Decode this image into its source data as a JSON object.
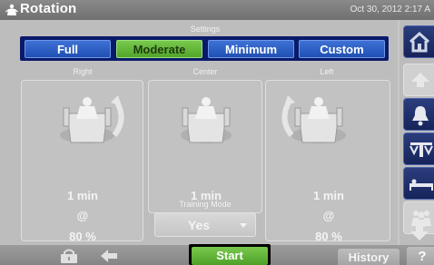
{
  "app": {
    "title": "Rotation",
    "datetime": "Oct 30, 2012 2:17 A"
  },
  "settings": {
    "label": "Settings",
    "options": [
      "Full",
      "Moderate",
      "Minimum",
      "Custom"
    ],
    "selected": "Moderate"
  },
  "columns": {
    "right": {
      "label": "Right",
      "duration": "1 min",
      "at": "@",
      "percent": "80 %"
    },
    "center": {
      "label": "Center",
      "duration": "1 min"
    },
    "left": {
      "label": "Left",
      "duration": "1 min",
      "at": "@",
      "percent": "80 %"
    }
  },
  "training_mode": {
    "label": "Training Mode",
    "value": "Yes"
  },
  "bottom": {
    "start_label": "Start",
    "history_label": "History",
    "help_label": "?"
  },
  "icons": {
    "title": "bed-rotation-icon",
    "sidebar": [
      "home-icon",
      "up-arrow-icon",
      "bell-icon",
      "scale-icon",
      "bed-flat-icon",
      "group-icon",
      "down-arrow-icon"
    ],
    "bottom": [
      "lock-icon",
      "back-arrow-icon"
    ]
  },
  "colors": {
    "accent_blue": "#1f4fb2",
    "selected_green": "#5eb233",
    "settings_frame": "#0a1a6a",
    "sidebar_dark": "#1d2c66"
  }
}
